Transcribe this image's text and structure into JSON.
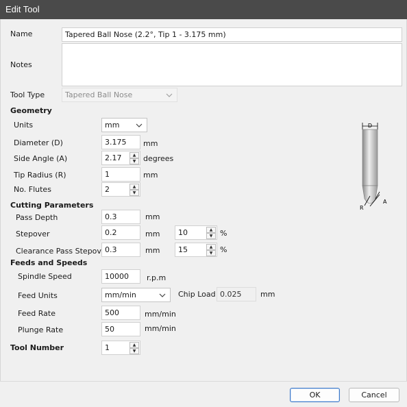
{
  "window": {
    "title": "Edit Tool"
  },
  "header": {
    "name_label": "Name",
    "name_value": "Tapered Ball Nose (2.2°, Tip 1 - 3.175 mm)",
    "notes_label": "Notes",
    "notes_value": "",
    "tool_type_label": "Tool Type",
    "tool_type_value": "Tapered Ball Nose"
  },
  "geometry": {
    "heading": "Geometry",
    "units_label": "Units",
    "units_value": "mm",
    "diameter_label": "Diameter (D)",
    "diameter_value": "3.175",
    "diameter_unit": "mm",
    "side_angle_label": "Side Angle (A)",
    "side_angle_value": "2.17",
    "side_angle_unit": "degrees",
    "tip_radius_label": "Tip Radius (R)",
    "tip_radius_value": "1",
    "tip_radius_unit": "mm",
    "flutes_label": "No. Flutes",
    "flutes_value": "2",
    "diagram": {
      "d_label": "D",
      "r_label": "R",
      "a_label": "A"
    }
  },
  "cutting": {
    "heading": "Cutting Parameters",
    "pass_depth_label": "Pass Depth",
    "pass_depth_value": "0.3",
    "pass_depth_unit": "mm",
    "stepover_label": "Stepover",
    "stepover_value": "0.2",
    "stepover_unit": "mm",
    "stepover_percent": "10",
    "stepover_percent_unit": "%",
    "clearance_label": "Clearance Pass Stepover",
    "clearance_value": "0.3",
    "clearance_unit": "mm",
    "clearance_percent": "15",
    "clearance_percent_unit": "%"
  },
  "feeds": {
    "heading": "Feeds and Speeds",
    "spindle_label": "Spindle Speed",
    "spindle_value": "10000",
    "spindle_unit": "r.p.m",
    "feed_units_label": "Feed Units",
    "feed_units_value": "mm/min",
    "chip_load_label": "Chip Load",
    "chip_load_value": "0.025",
    "chip_load_unit": "mm",
    "feed_rate_label": "Feed Rate",
    "feed_rate_value": "500",
    "feed_rate_unit": "mm/min",
    "plunge_rate_label": "Plunge Rate",
    "plunge_rate_value": "50",
    "plunge_rate_unit": "mm/min"
  },
  "tool_number": {
    "label": "Tool Number",
    "value": "1"
  },
  "footer": {
    "ok_label": "OK",
    "cancel_label": "Cancel"
  },
  "icons": {
    "dropdown": "chevron-down-icon",
    "spin_up": "caret-up-icon",
    "spin_down": "caret-down-icon"
  },
  "colors": {
    "titlebar": "#4a4a4a",
    "default_button_border": "#3b77c7",
    "background": "#f0f0f0"
  }
}
